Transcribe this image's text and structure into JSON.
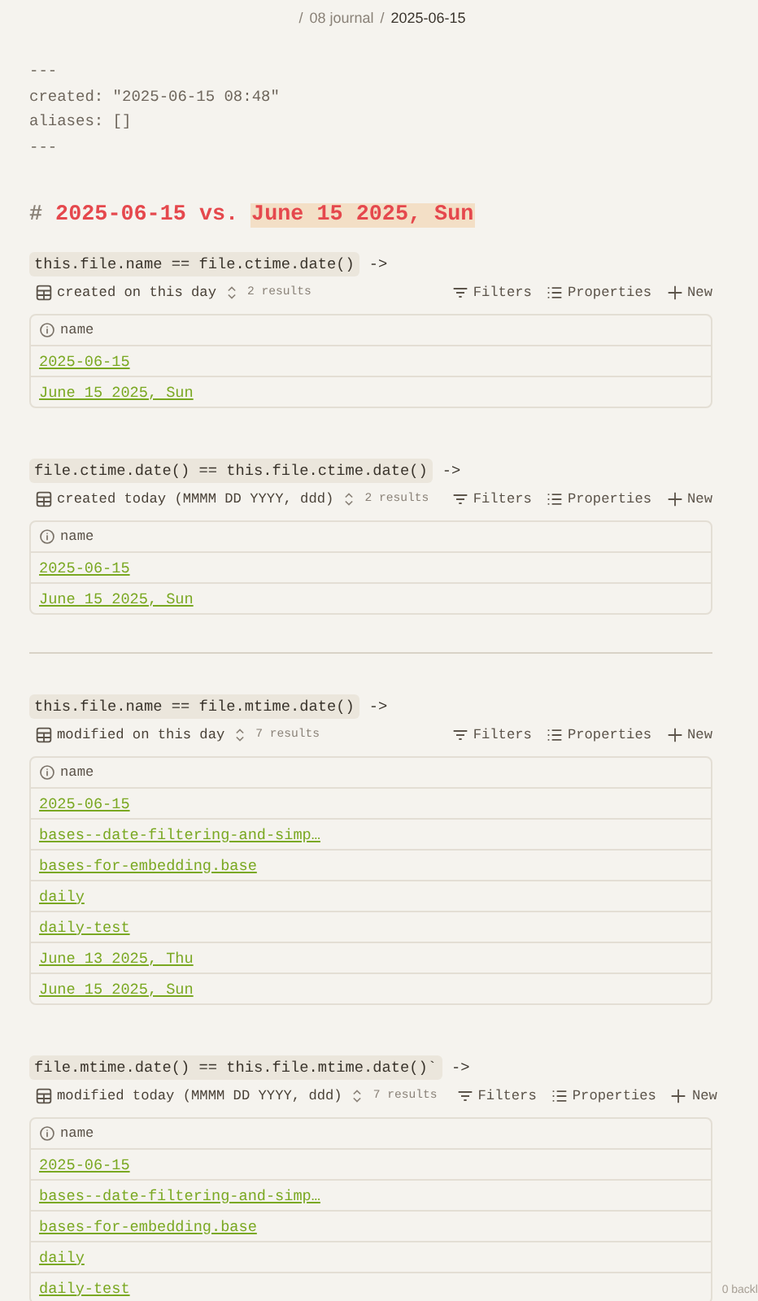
{
  "breadcrumb": [
    {
      "sep": "/",
      "label": "08 journal"
    },
    {
      "sep": "/",
      "label": "2025-06-15"
    }
  ],
  "frontmatter": [
    "---",
    "created: \"2025-06-15 08:48\"",
    "aliases: []",
    "---"
  ],
  "heading": {
    "mark": "#",
    "text": "2025-06-15 vs.",
    "highlighted": "June 15 2025, Sun"
  },
  "blocks": [
    {
      "kind": "query",
      "code": "this.file.name == file.ctime.date()",
      "arrow": "->",
      "view": "created on this day",
      "results": "2 results",
      "actions": [
        "Filters",
        "Properties",
        "New"
      ],
      "column": "name",
      "rows": [
        "2025-06-15",
        "June 15 2025, Sun"
      ]
    },
    {
      "kind": "query",
      "code": "file.ctime.date() == this.file.ctime.date()",
      "arrow": "->",
      "view": "created today (MMMM DD YYYY, ddd)",
      "results": "2 results",
      "actions": [
        "Filters",
        "Properties",
        "New"
      ],
      "column": "name",
      "rows": [
        "2025-06-15",
        "June 15 2025, Sun"
      ]
    },
    {
      "kind": "divider"
    },
    {
      "kind": "query",
      "code": "this.file.name == file.mtime.date()",
      "arrow": "->",
      "view": "modified on this day",
      "results": "7 results",
      "actions": [
        "Filters",
        "Properties",
        "New"
      ],
      "column": "name",
      "rows": [
        "2025-06-15",
        "bases--date-filtering-and-simp…",
        "bases-for-embedding.base",
        "daily",
        "daily-test",
        "June 13 2025, Thu",
        "June 15 2025, Sun"
      ]
    },
    {
      "kind": "query",
      "code": "file.mtime.date() == this.file.mtime.date()`",
      "arrow": "->",
      "view": "modified today (MMMM DD YYYY, ddd)",
      "results": "7 results",
      "actions": [
        "Filters",
        "Properties",
        "New"
      ],
      "column": "name",
      "rows": [
        "2025-06-15",
        "bases--date-filtering-and-simp…",
        "bases-for-embedding.base",
        "daily",
        "daily-test"
      ]
    }
  ],
  "footer": "0 backl"
}
